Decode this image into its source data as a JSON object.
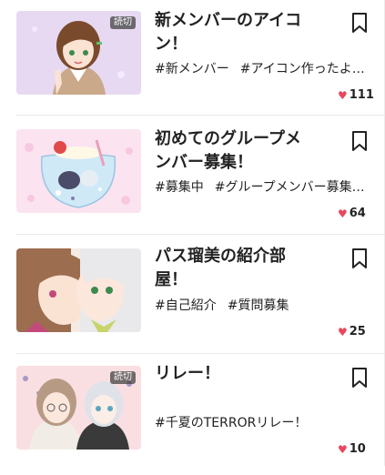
{
  "colors": {
    "heart": "#e8475f",
    "badge_bg": "#4b4b4b",
    "divider": "#e9e9e9"
  },
  "posts": [
    {
      "title": "新メンバーのアイコン！",
      "badge": "読切",
      "tags": [
        "#新メンバー",
        "#アイコン作ったよ！"
      ],
      "likes": "111",
      "icon": "bookmark-outline-icon"
    },
    {
      "title": "初めてのグループメンバー募集！",
      "badge": "",
      "tags": [
        "#募集中",
        "#グループメンバー募集…"
      ],
      "likes": "64",
      "icon": "bookmark-outline-icon"
    },
    {
      "title": "パス瑠美の紹介部屋！",
      "badge": "",
      "tags": [
        "#自己紹介",
        "#質問募集"
      ],
      "likes": "25",
      "icon": "bookmark-outline-icon"
    },
    {
      "title": "リレー！",
      "badge": "読切",
      "tags": [
        "#千夏のTERRORリレー！"
      ],
      "likes": "10",
      "icon": "bookmark-outline-icon"
    }
  ]
}
